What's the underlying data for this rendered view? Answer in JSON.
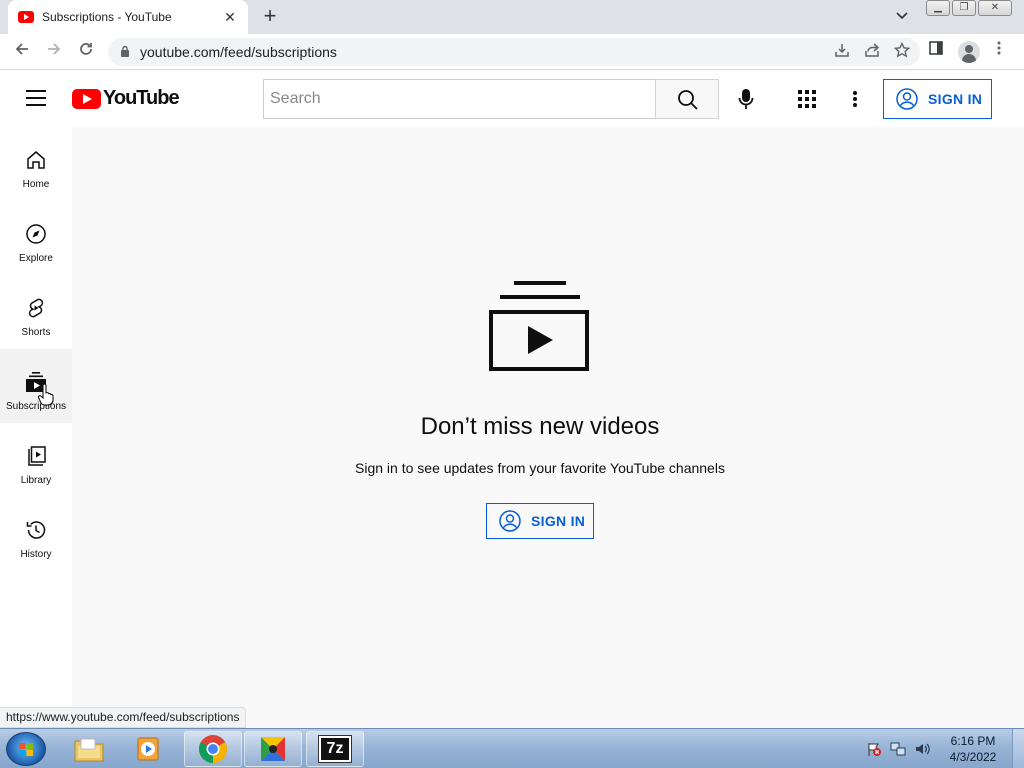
{
  "browser": {
    "tab_title": "Subscriptions - YouTube",
    "tab_close": "✕",
    "new_tab": "+",
    "tab_dropdown": "⌄",
    "url": "youtube.com/feed/subscriptions",
    "status_url": "https://www.youtube.com/feed/subscriptions"
  },
  "header": {
    "logo_text": "YouTube",
    "search_placeholder": "Search",
    "sign_in_label": "SIGN IN"
  },
  "sidebar": {
    "items": [
      {
        "label": "Home",
        "icon": "home-icon"
      },
      {
        "label": "Explore",
        "icon": "compass-icon"
      },
      {
        "label": "Shorts",
        "icon": "shorts-icon"
      },
      {
        "label": "Subscriptions",
        "icon": "subscriptions-icon",
        "active": true
      },
      {
        "label": "Library",
        "icon": "library-icon"
      },
      {
        "label": "History",
        "icon": "history-icon"
      }
    ]
  },
  "main": {
    "title": "Don’t miss new videos",
    "subtitle": "Sign in to see updates from your favorite YouTube channels",
    "sign_in_label": "SIGN IN"
  },
  "taskbar": {
    "time": "6:16 PM",
    "date": "4/3/2022",
    "apps": [
      "file-explorer",
      "media-player",
      "chrome",
      "multicolor-app",
      "7-zip"
    ],
    "seven_zip_label": "7z"
  },
  "colors": {
    "youtube_red": "#ff0000",
    "link_blue": "#065fd4",
    "background": "#f9f9f9"
  }
}
